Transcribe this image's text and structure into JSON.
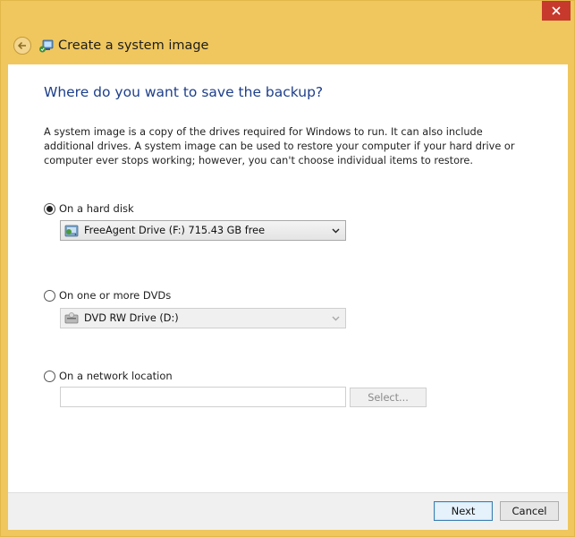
{
  "window": {
    "title": "Create a system image",
    "close_label": "Close"
  },
  "page": {
    "heading": "Where do you want to save the backup?",
    "description": "A system image is a copy of the drives required for Windows to run. It can also include additional drives. A system image can be used to restore your computer if your hard drive or computer ever stops working; however, you can't choose individual items to restore."
  },
  "options": {
    "hard_disk": {
      "label": "On a hard disk",
      "checked": true,
      "selected_drive": "FreeAgent Drive (F:)  715.43 GB free"
    },
    "dvd": {
      "label": "On one or more DVDs",
      "checked": false,
      "selected_drive": "DVD RW Drive (D:)"
    },
    "network": {
      "label": "On a network location",
      "checked": false,
      "path_value": "",
      "select_label": "Select..."
    }
  },
  "footer": {
    "next_label": "Next",
    "cancel_label": "Cancel"
  },
  "colors": {
    "frame": "#f0c75e",
    "heading": "#1e3f8a",
    "close": "#c7392c",
    "primary_border": "#3c7fb1"
  }
}
